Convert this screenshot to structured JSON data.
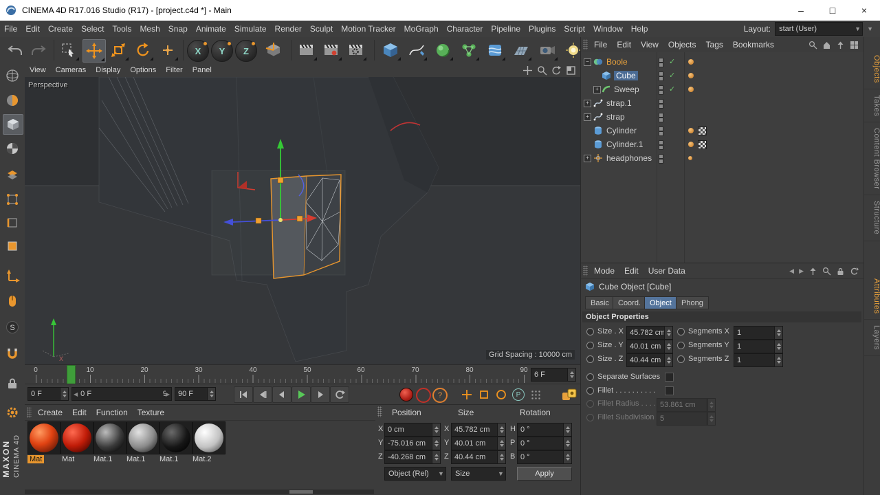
{
  "window": {
    "title": "CINEMA 4D R17.016 Studio (R17) - [project.c4d *] - Main",
    "controls": {
      "minimize": "–",
      "maximize": "□",
      "close": "×"
    }
  },
  "menubar": {
    "items": [
      "File",
      "Edit",
      "Create",
      "Select",
      "Tools",
      "Mesh",
      "Snap",
      "Animate",
      "Simulate",
      "Render",
      "Sculpt",
      "Motion Tracker",
      "MoGraph",
      "Character",
      "Pipeline",
      "Plugins",
      "Script",
      "Window",
      "Help"
    ],
    "layout_label": "Layout:",
    "layout_value": "start (User)"
  },
  "toolbar": {
    "axis": [
      "X",
      "Y",
      "Z"
    ]
  },
  "viewport": {
    "menus": [
      "View",
      "Cameras",
      "Display",
      "Options",
      "Filter",
      "Panel"
    ],
    "camera_label": "Perspective",
    "grid_spacing": "Grid Spacing : 10000 cm",
    "axis_label_x": "X"
  },
  "timeline": {
    "ticks": [
      "0",
      "10",
      "20",
      "30",
      "40",
      "50",
      "60",
      "70",
      "80",
      "90"
    ],
    "current_frame_field": "6 F",
    "range_start": "0 F",
    "preview_start": "0 F",
    "preview_end": "90 F",
    "range_end": "90 F"
  },
  "animbar": {
    "p_label": "P"
  },
  "object_manager": {
    "menus": [
      "File",
      "Edit",
      "View",
      "Objects",
      "Tags",
      "Bookmarks"
    ],
    "objects": [
      {
        "name": "Boole"
      },
      {
        "name": "Cube"
      },
      {
        "name": "Sweep"
      },
      {
        "name": "strap.1"
      },
      {
        "name": "strap"
      },
      {
        "name": "Cylinder"
      },
      {
        "name": "Cylinder.1"
      },
      {
        "name": "headphones"
      }
    ]
  },
  "attributes_panel": {
    "menus": [
      "Mode",
      "Edit",
      "User Data"
    ],
    "object_title": "Cube Object [Cube]",
    "tabs": [
      "Basic",
      "Coord.",
      "Object",
      "Phong"
    ],
    "section_title": "Object Properties",
    "size_x_label": "Size . X",
    "size_x_value": "45.782 cm",
    "size_y_label": "Size . Y",
    "size_y_value": "40.01 cm",
    "size_z_label": "Size . Z",
    "size_z_value": "40.44 cm",
    "segments_x_label": "Segments X",
    "segments_x_value": "1",
    "segments_y_label": "Segments Y",
    "segments_y_value": "1",
    "segments_z_label": "Segments Z",
    "segments_z_value": "1",
    "separate_surfaces_label": "Separate Surfaces",
    "fillet_label": "Fillet . . . . . . . . . .",
    "fillet_radius_label": "Fillet Radius . . . .",
    "fillet_radius_value": "53.861 cm",
    "fillet_subdivision_label": "Fillet Subdivision",
    "fillet_subdivision_value": "5"
  },
  "material_manager": {
    "menus": [
      "Create",
      "Edit",
      "Function",
      "Texture"
    ],
    "materials": [
      {
        "name": "Mat"
      },
      {
        "name": "Mat"
      },
      {
        "name": "Mat.1"
      },
      {
        "name": "Mat.1"
      },
      {
        "name": "Mat.1"
      },
      {
        "name": "Mat.2"
      }
    ]
  },
  "coordinates_panel": {
    "headers": [
      "Position",
      "Size",
      "Rotation"
    ],
    "pos_labels": [
      "X",
      "Y",
      "Z"
    ],
    "rot_labels": [
      "H",
      "P",
      "B"
    ],
    "position": [
      "0 cm",
      "-75.016 cm",
      "-40.268 cm"
    ],
    "size": [
      "45.782 cm",
      "40.01 cm",
      "40.44 cm"
    ],
    "rotation": [
      "0 °",
      "0 °",
      "0 °"
    ],
    "mode_object": "Object (Rel)",
    "mode_size": "Size",
    "apply_label": "Apply"
  },
  "side_tabs": {
    "top": [
      "Objects",
      "Takes",
      "Content Browser",
      "Structure"
    ],
    "bottom": [
      "Attributes",
      "Layers"
    ]
  },
  "branding": {
    "maxon": "MAXON",
    "cinema": "CINEMA 4D"
  },
  "icons": {
    "check": "✓",
    "expander_open": "−",
    "expander_closed": "+",
    "question": "?",
    "snap_s": "S"
  },
  "colors": {
    "accent_orange": "#e8962e",
    "selection_blue": "#4a6b94",
    "axis_x": "#d63c30",
    "axis_y": "#35c935",
    "axis_z": "#4450d8"
  }
}
